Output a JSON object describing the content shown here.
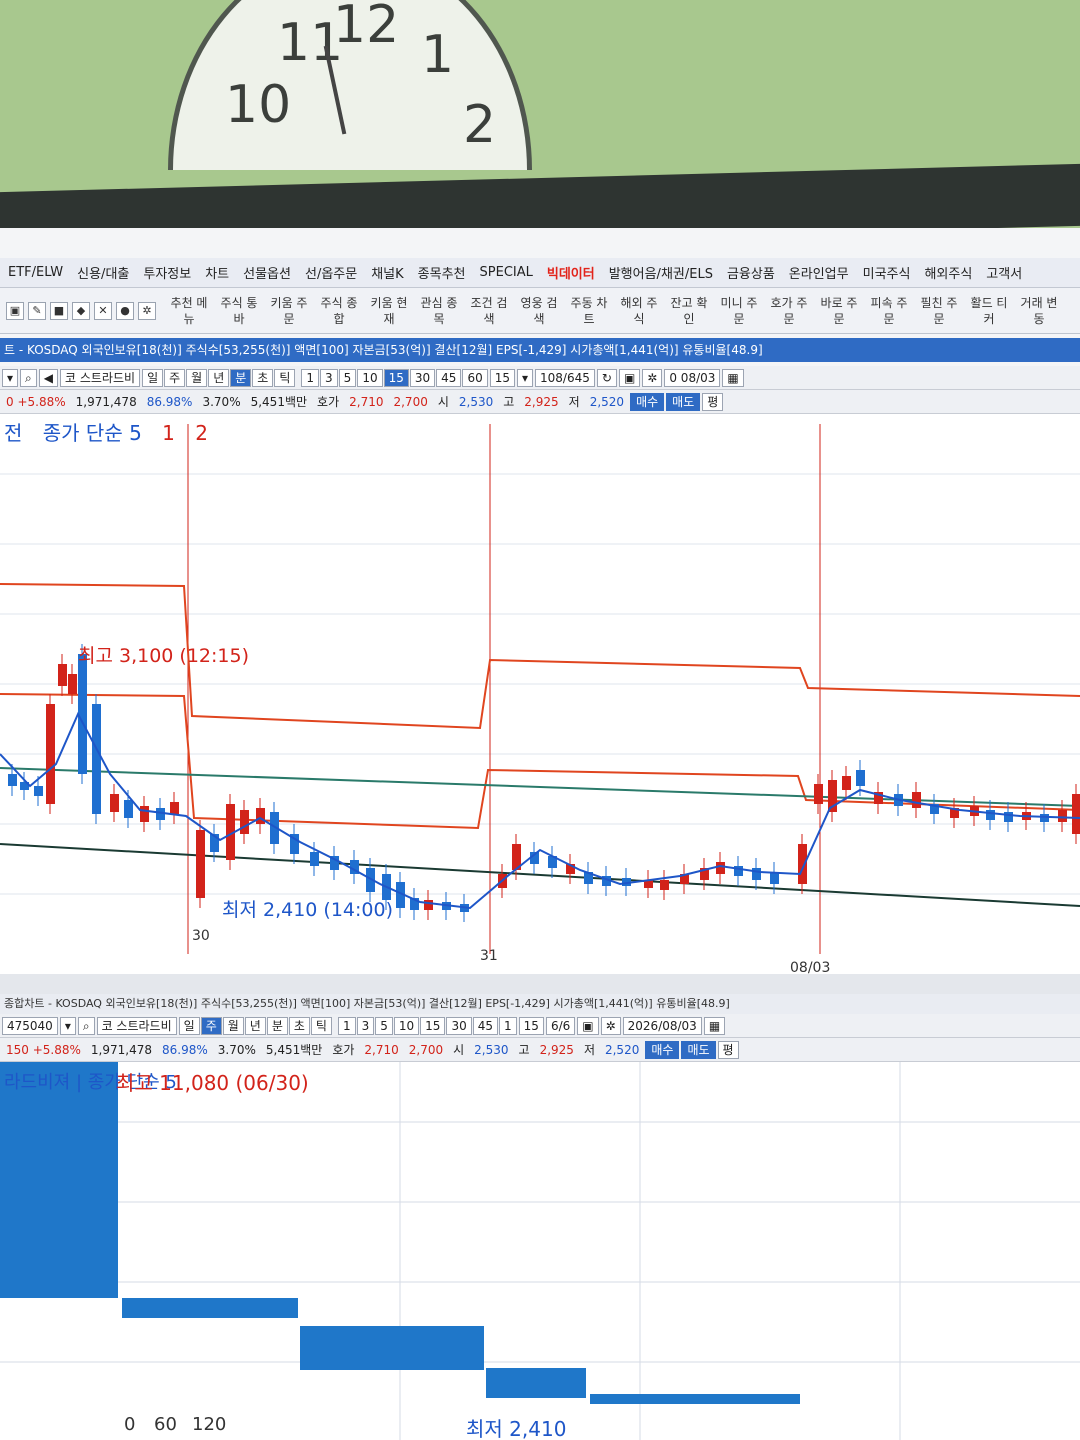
{
  "menu": {
    "items": [
      "ETF/ELW",
      "신용/대출",
      "투자정보",
      "차트",
      "선물옵션",
      "선/옵주문",
      "채널K",
      "종목추천",
      "SPECIAL",
      "빅데이터",
      "발행어음/채권/ELS",
      "금융상품",
      "온라인업무",
      "미국주식",
      "해외주식",
      "고객서"
    ],
    "highlight_index": 9
  },
  "toolbar": {
    "buttons": [
      "추천 메뉴",
      "주식 통바",
      "키움 주문",
      "주식 종합",
      "키움 현재",
      "관심 종목",
      "조건 검색",
      "영웅 검색",
      "주동 차트",
      "해외 주식",
      "잔고 확인",
      "미니 주문",
      "호가 주문",
      "바로 주문",
      "피속 주문",
      "필친 주문",
      "활드 티커",
      "거래 변동"
    ]
  },
  "chart1": {
    "info": "트 - KOSDAQ 외국인보유[18(천)] 주식수[53,255(천)] 액면[100] 자본금[53(억)] 결산[12월] EPS[-1,429] 시가총액[1,441(억)] 유통비율[48.9]",
    "ctrl_row1": {
      "name": "코 스트라드비",
      "periods": [
        "일",
        "주",
        "월",
        "년",
        "분",
        "초",
        "틱"
      ],
      "selected_period": "분",
      "intervals": [
        "1",
        "3",
        "5",
        "10",
        "15",
        "30",
        "45",
        "60"
      ],
      "selected_interval": "15",
      "interval_value": "15",
      "count": "108/645",
      "date": "0 08/03"
    },
    "ctrl_row2": {
      "rate": "0 +5.88%",
      "volume": "1,971,478",
      "ratio": "86.98%",
      "ratio2": "3.70%",
      "amount": "5,451백만",
      "hoga_label": "호가",
      "hoga": "2,710",
      "price2": "2,700",
      "low_label_s": "시",
      "open": "2,530",
      "high_label": "고",
      "high": "2,925",
      "low_label": "저",
      "low": "2,520",
      "buy": "매수",
      "sell": "매도",
      "extra": "평"
    },
    "legend": {
      "prefix": "전",
      "text": "종가 단순 5",
      "n1": "1",
      "n2": "2"
    },
    "high_note": "최고 3,100 (12:15)",
    "low_note": "최저 2,410 (14:00)",
    "date_labels": [
      "30",
      "31",
      "08/03"
    ]
  },
  "chart2": {
    "info": "종합차트 - KOSDAQ 외국인보유[18(천)] 주식수[53,255(천)] 액면[100] 자본금[53(억)] 결산[12월] EPS[-1,429] 시가총액[1,441(억)] 유통비율[48.9]",
    "code": "475040",
    "name": "코 스트라드비",
    "periods": [
      "일",
      "주",
      "월",
      "년",
      "분",
      "초",
      "틱"
    ],
    "intervals": [
      "1",
      "3",
      "5",
      "10",
      "15",
      "30",
      "45",
      "1"
    ],
    "interval_value": "15",
    "count": "6/6",
    "date": "2026/08/03",
    "row2": {
      "rate": "150 +5.88%",
      "volume": "1,971,478",
      "ratio": "86.98%",
      "ratio2": "3.70%",
      "amount": "5,451백만",
      "hoga_label": "호가",
      "hoga": "2,710",
      "price2": "2,700",
      "open_label": "시",
      "open": "2,530",
      "high_label": "고",
      "high": "2,925",
      "low_label": "저",
      "low": "2,520",
      "buy": "매수",
      "sell": "매도",
      "extra": "평"
    },
    "legend": "라드비져 | 종가 단순 5",
    "high_note": "최고 11,080 (06/30)",
    "low_note": "최저 2,410",
    "axis_labels": [
      "0",
      "60",
      "120"
    ]
  }
}
